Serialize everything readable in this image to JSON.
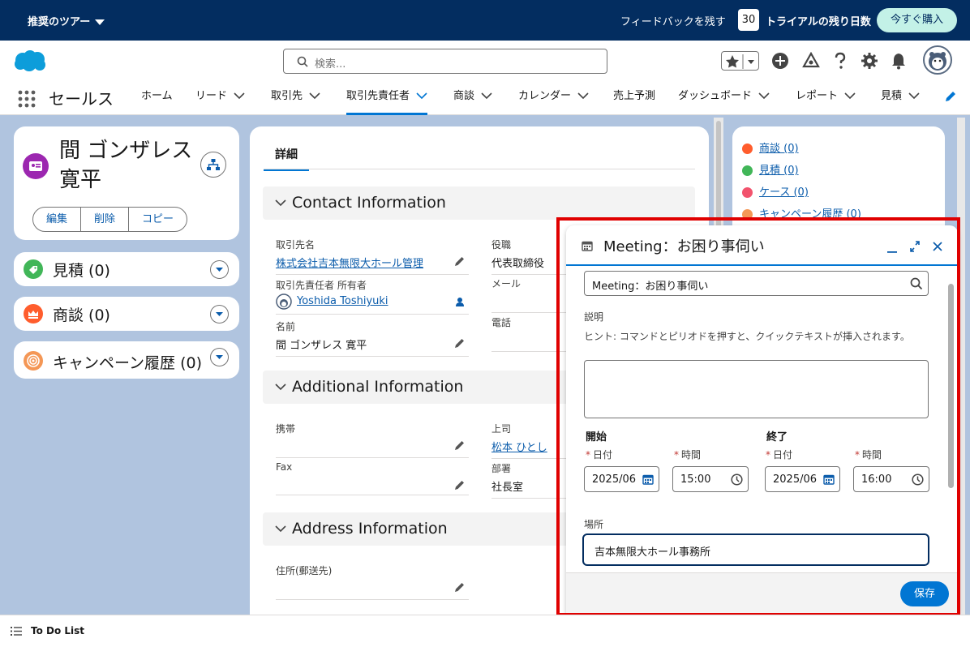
{
  "topbar": {
    "tour": "推奨のツアー",
    "feedback": "フィードバックを残す",
    "days": "30",
    "trial": "トライアルの残り日数",
    "buy": "今すぐ購入"
  },
  "header": {
    "search_placeholder": "検索...",
    "app_name": "セールス",
    "nav": [
      {
        "label": "ホーム",
        "dropdown": false
      },
      {
        "label": "リード",
        "dropdown": true
      },
      {
        "label": "取引先",
        "dropdown": true
      },
      {
        "label": "取引先責任者",
        "dropdown": true,
        "active": true
      },
      {
        "label": "商談",
        "dropdown": true
      },
      {
        "label": "カレンダー",
        "dropdown": true
      },
      {
        "label": "売上予測",
        "dropdown": false
      },
      {
        "label": "ダッシュボード",
        "dropdown": true
      },
      {
        "label": "レポート",
        "dropdown": true
      },
      {
        "label": "見積",
        "dropdown": true
      }
    ]
  },
  "contact": {
    "name": "間 ゴンザレス 寛平",
    "buttons": [
      "編集",
      "削除",
      "コピー"
    ]
  },
  "related_left": [
    {
      "label": "見積 (0)",
      "color": "#41b658"
    },
    {
      "label": "商談 (0)",
      "color": "#ff5d2d"
    },
    {
      "label": "キャンペーン履歴 (0)",
      "color": "#f49756"
    }
  ],
  "detail": {
    "tab": "詳細",
    "sections": [
      "Contact Information",
      "Additional Information",
      "Address Information"
    ],
    "fields": {
      "account_label": "取引先名",
      "account_value": "株式会社吉本無限大ホール管理",
      "title_label": "役職",
      "title_value": "代表取締役",
      "owner_label": "取引先責任者 所有者",
      "owner_value": "Yoshida Toshiyuki",
      "email_label": "メール",
      "name_label": "名前",
      "name_value": "間 ゴンザレス 寛平",
      "phone_label": "電話",
      "mobile_label": "携帯",
      "boss_label": "上司",
      "boss_value": "松本 ひとし",
      "fax_label": "Fax",
      "dept_label": "部署",
      "dept_value": "社長室",
      "address_label": "住所(郵送先)"
    }
  },
  "related_right": [
    {
      "label": "商談 (0)",
      "color": "#ff5d2d"
    },
    {
      "label": "見積 (0)",
      "color": "#41b658"
    },
    {
      "label": "ケース (0)",
      "color": "#f2536d"
    },
    {
      "label": "キャンペーン履歴 (0)",
      "color": "#f49756"
    }
  ],
  "modal": {
    "title": "Meeting：お困り事伺い",
    "subject": "Meeting：お困り事伺い",
    "desc_label": "説明",
    "hint": "ヒント: コマンドとピリオドを押すと、クイックテキストが挿入されます。",
    "start_label": "開始",
    "end_label": "終了",
    "date_label": "日付",
    "time_label": "時間",
    "start_date": "2025/06",
    "start_time": "15:00",
    "end_date": "2025/06",
    "end_time": "16:00",
    "location_label": "場所",
    "location_value": "吉本無限大ホール事務所",
    "save": "保存"
  },
  "footer": {
    "todo": "To Do List"
  }
}
